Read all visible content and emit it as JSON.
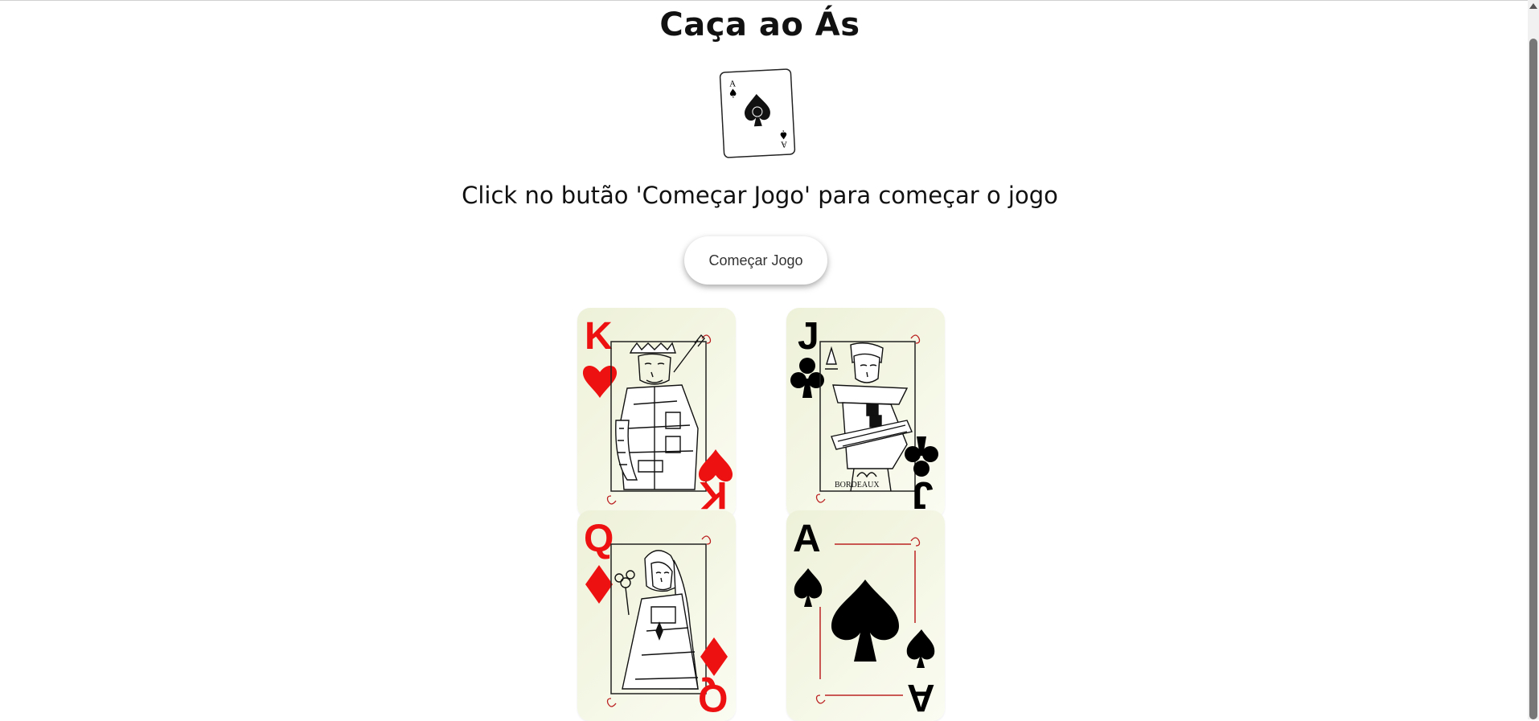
{
  "title": "Caça ao Ás",
  "logo_card": {
    "rank": "A",
    "suit": "spade"
  },
  "message": "Click no butão 'Começar Jogo' para começar o jogo",
  "start_button": "Começar Jogo",
  "cards": [
    {
      "rank": "K",
      "suit": "heart",
      "color": "#ee1111"
    },
    {
      "rank": "J",
      "suit": "club",
      "color": "#000000"
    },
    {
      "rank": "Q",
      "suit": "diamond",
      "color": "#ee1111"
    },
    {
      "rank": "A",
      "suit": "spade",
      "color": "#000000"
    }
  ],
  "colors": {
    "card_background": "#f2f4df",
    "red_suit": "#ee1111",
    "black_suit": "#000000"
  },
  "icons": [
    "spade-icon",
    "heart-icon",
    "club-icon",
    "diamond-icon"
  ]
}
